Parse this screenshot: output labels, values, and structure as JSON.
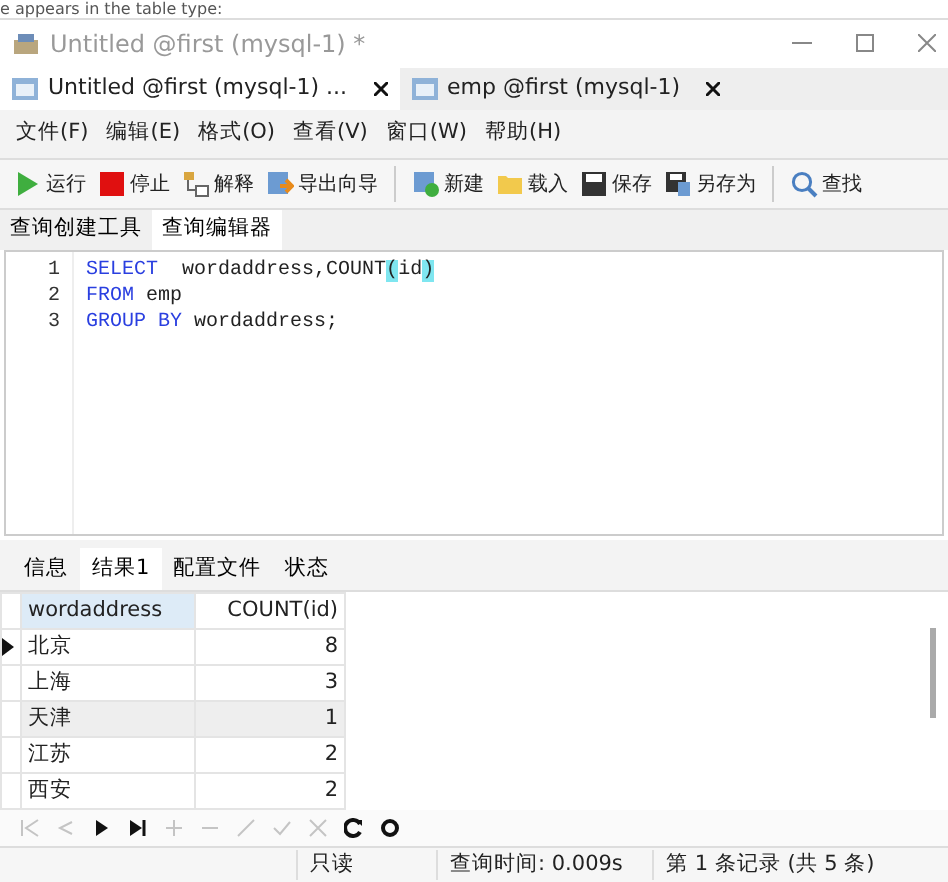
{
  "background_text": "e appears in the table type:",
  "window": {
    "title": "Untitled @first (mysql-1) *"
  },
  "doc_tabs": [
    {
      "label": "Untitled @first (mysql-1) ...",
      "selected": true
    },
    {
      "label": "emp @first (mysql-1)",
      "selected": false
    }
  ],
  "menu": [
    "文件(F)",
    "编辑(E)",
    "格式(O)",
    "查看(V)",
    "窗口(W)",
    "帮助(H)"
  ],
  "toolbar": [
    {
      "kind": "run",
      "label": "运行"
    },
    {
      "kind": "stop",
      "label": "停止"
    },
    {
      "kind": "explain",
      "label": "解释"
    },
    {
      "kind": "export",
      "label": "导出向导"
    },
    {
      "kind": "sep"
    },
    {
      "kind": "new",
      "label": "新建"
    },
    {
      "kind": "load",
      "label": "载入"
    },
    {
      "kind": "save",
      "label": "保存"
    },
    {
      "kind": "saveas",
      "label": "另存为"
    },
    {
      "kind": "sep"
    },
    {
      "kind": "find",
      "label": "查找"
    }
  ],
  "editor_tabs": [
    {
      "label": "查询创建工具",
      "selected": false
    },
    {
      "label": "查询编辑器",
      "selected": true
    }
  ],
  "code": [
    {
      "number": "1",
      "tokens": [
        {
          "kind": "keyword",
          "text": "SELECT"
        },
        {
          "kind": "text",
          "text": "  wordaddress,COUNT"
        },
        {
          "kind": "match",
          "text": "("
        },
        {
          "kind": "text",
          "text": "id"
        },
        {
          "kind": "match",
          "text": ")"
        }
      ]
    },
    {
      "number": "2",
      "tokens": [
        {
          "kind": "keyword",
          "text": "FROM"
        },
        {
          "kind": "text",
          "text": " emp"
        }
      ]
    },
    {
      "number": "3",
      "tokens": [
        {
          "kind": "keyword",
          "text": "GROUP BY"
        },
        {
          "kind": "text",
          "text": " wordaddress;"
        }
      ]
    }
  ],
  "result_tabs": [
    {
      "label": "信息",
      "selected": false
    },
    {
      "label": "结果1",
      "selected": true
    },
    {
      "label": "配置文件",
      "selected": false
    },
    {
      "label": "状态",
      "selected": false
    }
  ],
  "table": {
    "columns": [
      "wordaddress",
      "COUNT(id)"
    ],
    "rows": [
      {
        "cells": [
          "北京",
          "8"
        ],
        "current": true,
        "selected": false
      },
      {
        "cells": [
          "上海",
          "3"
        ],
        "current": false,
        "selected": false
      },
      {
        "cells": [
          "天津",
          "1"
        ],
        "current": false,
        "selected": true
      },
      {
        "cells": [
          "江苏",
          "2"
        ],
        "current": false,
        "selected": false
      },
      {
        "cells": [
          "西安",
          "2"
        ],
        "current": false,
        "selected": false
      }
    ]
  },
  "nav": [
    {
      "kind": "first",
      "disabled": true
    },
    {
      "kind": "prev",
      "disabled": true
    },
    {
      "kind": "next",
      "disabled": false
    },
    {
      "kind": "last",
      "disabled": false
    },
    {
      "kind": "add",
      "disabled": true
    },
    {
      "kind": "delete",
      "disabled": true
    },
    {
      "kind": "edit",
      "disabled": true
    },
    {
      "kind": "apply",
      "disabled": true
    },
    {
      "kind": "cancel",
      "disabled": true
    },
    {
      "kind": "refresh",
      "disabled": false
    },
    {
      "kind": "stop",
      "disabled": false
    }
  ],
  "status_bar": [
    "只读",
    "查询时间: 0.009s",
    "第 1 条记录 (共 5 条)"
  ]
}
